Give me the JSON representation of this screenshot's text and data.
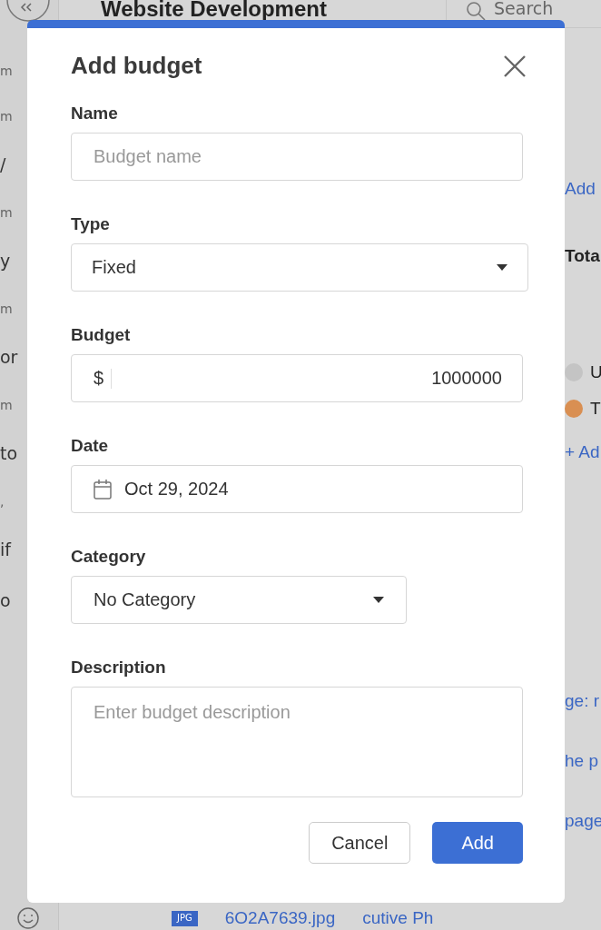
{
  "background": {
    "title": "Website Development",
    "search": {
      "placeholder": "Search"
    },
    "left_fragments": [
      {
        "text": "m",
        "kind": "small"
      },
      {
        "text": "m",
        "kind": "small"
      },
      {
        "text": "/",
        "kind": "text"
      },
      {
        "text": "m",
        "kind": "small"
      },
      {
        "text": "y",
        "kind": "text"
      },
      {
        "text": "m",
        "kind": "small"
      },
      {
        "text": "or",
        "kind": "text"
      },
      {
        "text": "m",
        "kind": "small"
      },
      {
        "text": "to",
        "kind": "text"
      },
      {
        "text": ",",
        "kind": "small"
      },
      {
        "text": "if",
        "kind": "text"
      },
      {
        "text": "o",
        "kind": "text"
      }
    ],
    "right_fragments": [
      {
        "text": "Add",
        "kind": "link"
      },
      {
        "text": "Tota",
        "kind": "heading"
      },
      {
        "text": "U",
        "kind": "dot",
        "color": "#c4c4c4"
      },
      {
        "text": "T",
        "kind": "dot",
        "color": "#d98f52"
      },
      {
        "text": "+ Ad",
        "kind": "link"
      },
      {
        "text": "ge: r",
        "kind": "link"
      },
      {
        "text": "he p",
        "kind": "link"
      },
      {
        "text": "page",
        "kind": "link"
      }
    ],
    "file_row": {
      "badge": "JPG",
      "name": "6O2A7639.jpg",
      "column_2": "cutive Ph"
    }
  },
  "dialog": {
    "title": "Add budget",
    "fields": [
      {
        "label": "Name",
        "kind": "text",
        "placeholder": "Budget name"
      },
      {
        "label": "Type",
        "kind": "select",
        "value": "Fixed"
      },
      {
        "label": "Budget",
        "kind": "money",
        "prefix": "$",
        "value": "1000000"
      },
      {
        "label": "Date",
        "kind": "date",
        "value": "Oct 29, 2024"
      },
      {
        "label": "Category",
        "kind": "select_narrow",
        "value": "No Category"
      },
      {
        "label": "Description",
        "kind": "textarea",
        "placeholder": "Enter budget description"
      }
    ],
    "buttons": [
      {
        "label": "Cancel",
        "kind": "secondary"
      },
      {
        "label": "Add",
        "kind": "primary"
      }
    ]
  }
}
